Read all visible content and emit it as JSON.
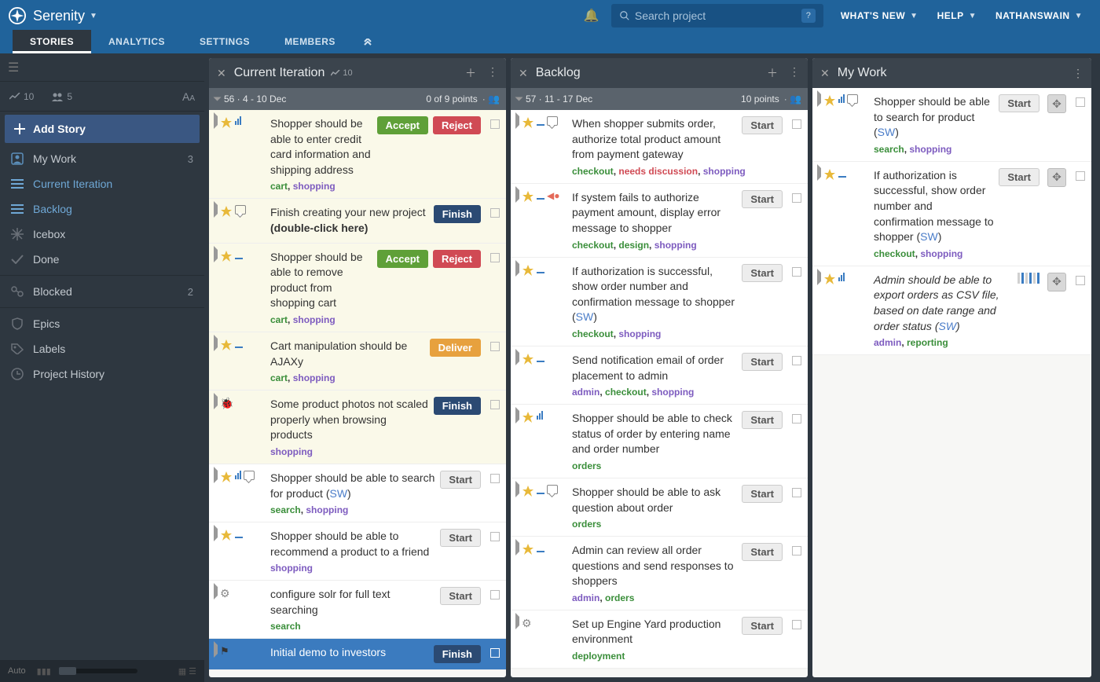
{
  "header": {
    "project": "Serenity",
    "search_placeholder": "Search project",
    "links": {
      "whatsnew": "WHAT'S NEW",
      "help": "HELP",
      "user": "NATHANSWAIN"
    }
  },
  "tabs": {
    "stories": "STORIES",
    "analytics": "ANALYTICS",
    "settings": "SETTINGS",
    "members": "MEMBERS"
  },
  "sidebar": {
    "velocity": "10",
    "members": "5",
    "add_story": "Add Story",
    "items": {
      "mywork": {
        "label": "My Work",
        "badge": "3"
      },
      "current": {
        "label": "Current Iteration"
      },
      "backlog": {
        "label": "Backlog"
      },
      "icebox": {
        "label": "Icebox"
      },
      "done": {
        "label": "Done"
      },
      "blocked": {
        "label": "Blocked",
        "badge": "2"
      },
      "epics": {
        "label": "Epics"
      },
      "labels": {
        "label": "Labels"
      },
      "history": {
        "label": "Project History"
      }
    },
    "auto": "Auto"
  },
  "panels": {
    "current": {
      "title": "Current Iteration",
      "meta": "10",
      "iter": {
        "label": "56 · 4 - 10 Dec",
        "points": "0 of 9 points"
      },
      "stories": [
        {
          "title": "Shopper should be able to enter credit card information and shipping address",
          "tag1": "cart",
          "tag2": "shopping",
          "buttons": [
            "accept",
            "reject"
          ],
          "estimate": "bars",
          "accepted": true
        },
        {
          "title_a": "Finish creating your new project ",
          "title_b": "(double-click here)",
          "tag1": "",
          "tag2": "",
          "buttons": [
            "finish"
          ],
          "icon": "comment",
          "accepted": true
        },
        {
          "title": "Shopper should be able to remove product from shopping cart",
          "tag1": "cart",
          "tag2": "shopping",
          "buttons": [
            "accept",
            "reject"
          ],
          "estimate": "dash",
          "accepted": true
        },
        {
          "title": "Cart manipulation should be AJAXy",
          "tag1": "cart",
          "tag2": "shopping",
          "buttons": [
            "deliver"
          ],
          "estimate": "dash",
          "accepted": true
        },
        {
          "title": "Some product photos not scaled properly when browsing products",
          "tag2": "shopping",
          "buttons": [
            "finish"
          ],
          "icon": "bug",
          "accepted": true
        },
        {
          "title_a": "Shopper should be able to search for product (",
          "initials": "SW",
          "title_c": ")",
          "tag1": "search",
          "tag2": "shopping",
          "buttons": [
            "start"
          ],
          "estimate": "bars",
          "hasComment": true
        },
        {
          "title": "Shopper should be able to recommend a product to a friend",
          "tag2": "shopping",
          "buttons": [
            "start"
          ],
          "estimate": "dash"
        },
        {
          "title": "configure solr for full text searching",
          "tag1": "search",
          "buttons": [
            "start"
          ],
          "icon": "gear"
        },
        {
          "title": "Initial demo to investors",
          "buttons": [
            "finish"
          ],
          "release": true
        }
      ]
    },
    "backlog": {
      "title": "Backlog",
      "iter": {
        "label": "57 · 11 - 17 Dec",
        "points": "10 points"
      },
      "stories": [
        {
          "title": "When shopper submits order, authorize total product amount from payment gateway",
          "tags": [
            "checkout",
            "needs discussion",
            "shopping"
          ],
          "tagColors": [
            "g",
            "r",
            "p"
          ],
          "buttons": [
            "start"
          ],
          "estimate": "dash",
          "hasComment": true
        },
        {
          "title": "If system fails to authorize payment amount, display error message to shopper",
          "tags": [
            "checkout",
            "design",
            "shopping"
          ],
          "tagColors": [
            "g",
            "g",
            "p"
          ],
          "buttons": [
            "start"
          ],
          "estimate": "dash",
          "blocker": true
        },
        {
          "title_a": "If authorization is successful, show order number and confirmation message to shopper (",
          "initials": "SW",
          "title_c": ")",
          "tags": [
            "checkout",
            "shopping"
          ],
          "tagColors": [
            "g",
            "p"
          ],
          "buttons": [
            "start"
          ],
          "estimate": "dash"
        },
        {
          "title": "Send notification email of order placement to admin",
          "tags": [
            "admin",
            "checkout",
            "shopping"
          ],
          "tagColors": [
            "p",
            "g",
            "p"
          ],
          "buttons": [
            "start"
          ],
          "estimate": "dash"
        },
        {
          "title": "Shopper should be able to check status of order by entering name and order number",
          "tags": [
            "orders"
          ],
          "tagColors": [
            "g"
          ],
          "buttons": [
            "start"
          ],
          "estimate": "bars"
        },
        {
          "title": "Shopper should be able to ask question about order",
          "tags": [
            "orders"
          ],
          "tagColors": [
            "g"
          ],
          "buttons": [
            "start"
          ],
          "estimate": "dash",
          "hasComment": true
        },
        {
          "title": "Admin can review all order questions and send responses to shoppers",
          "tags": [
            "admin",
            "orders"
          ],
          "tagColors": [
            "p",
            "g"
          ],
          "buttons": [
            "start"
          ],
          "estimate": "dash"
        },
        {
          "title": "Set up Engine Yard production environment",
          "tags": [
            "deployment"
          ],
          "tagColors": [
            "g"
          ],
          "buttons": [
            "start"
          ],
          "icon": "gear-plain"
        }
      ]
    },
    "mywork": {
      "title": "My Work",
      "stories": [
        {
          "title_a": "Shopper should be able to search for product (",
          "initials": "SW",
          "title_c": ")",
          "tags": [
            "search",
            "shopping"
          ],
          "tagColors": [
            "g",
            "p"
          ],
          "buttons": [
            "start"
          ],
          "estimate": "bars",
          "hasComment": true,
          "drag": true
        },
        {
          "title_a": "If authorization is successful, show order number and confirmation message to shopper (",
          "initials": "SW",
          "title_c": ")",
          "tags": [
            "checkout",
            "shopping"
          ],
          "tagColors": [
            "g",
            "p"
          ],
          "buttons": [
            "start"
          ],
          "estimate": "dash",
          "drag": true
        },
        {
          "title_a": "Admin should be able to export orders as CSV file, based on date range and order status (",
          "initials": "SW",
          "title_c": ")",
          "tags": [
            "admin",
            "reporting"
          ],
          "tagColors": [
            "p",
            "g"
          ],
          "italic": true,
          "buttons": [],
          "estimate": "bars",
          "drag": true,
          "mybars": true
        }
      ]
    }
  },
  "btnLabels": {
    "accept": "Accept",
    "reject": "Reject",
    "finish": "Finish",
    "deliver": "Deliver",
    "start": "Start"
  }
}
